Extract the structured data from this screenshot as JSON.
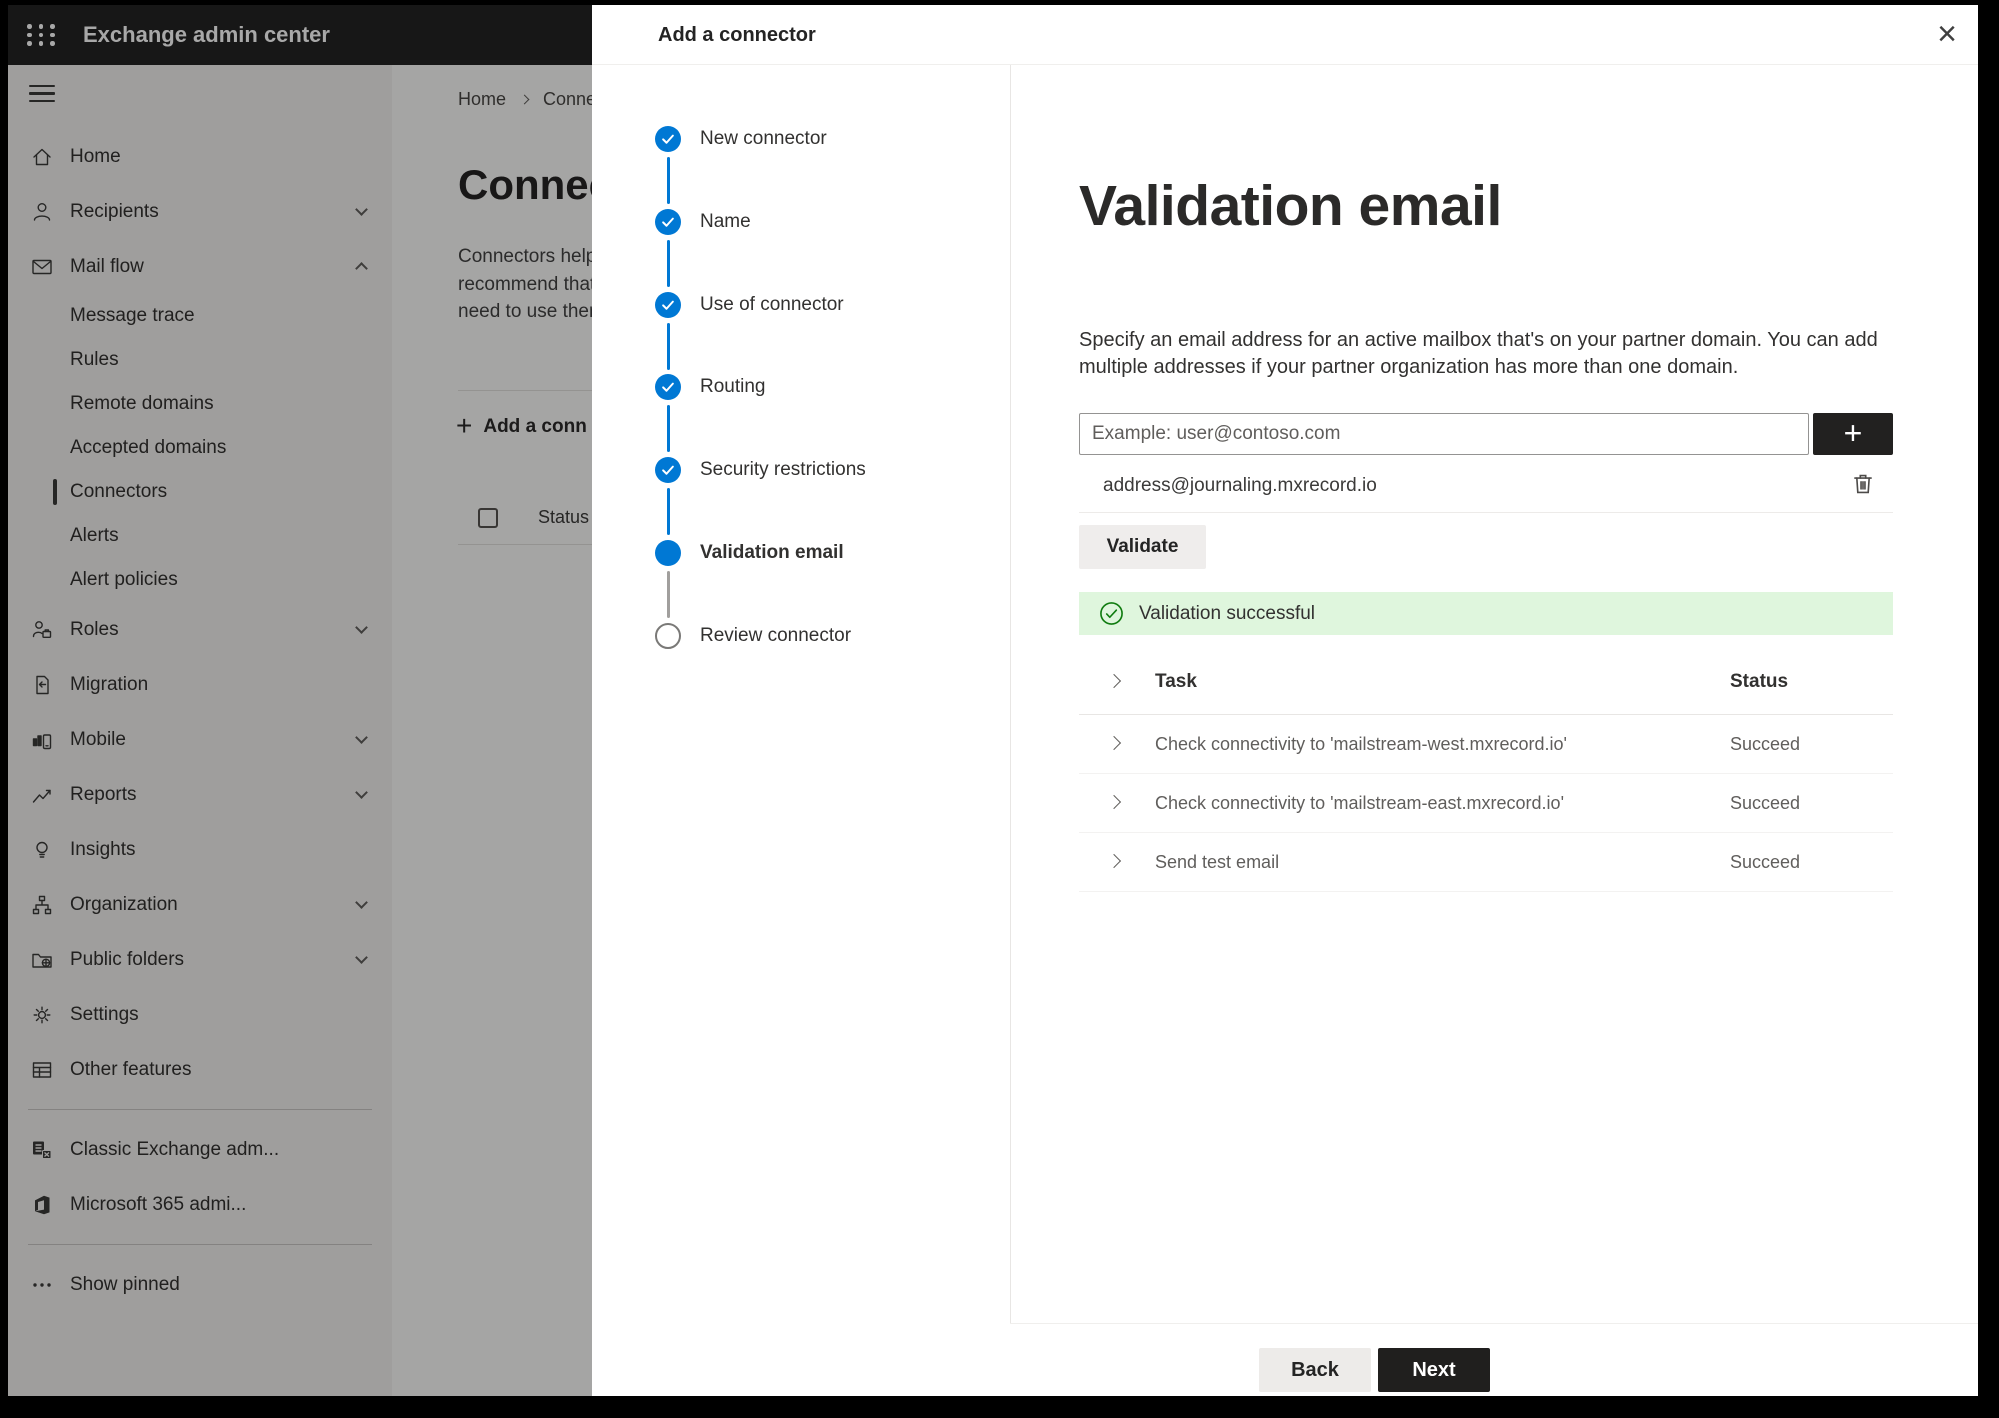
{
  "colors": {
    "accent": "#0078d4",
    "success_bg": "#dff6dd",
    "success_icon": "#107c10"
  },
  "top_bar": {
    "title": "Exchange admin center"
  },
  "sidebar": {
    "items": [
      {
        "icon": "home-icon",
        "label": "Home"
      },
      {
        "icon": "person-icon",
        "label": "Recipients",
        "chevron": "down"
      },
      {
        "icon": "mail-icon",
        "label": "Mail flow",
        "chevron": "up"
      },
      {
        "label": "Message trace",
        "sub": true
      },
      {
        "label": "Rules",
        "sub": true
      },
      {
        "label": "Remote domains",
        "sub": true
      },
      {
        "label": "Accepted domains",
        "sub": true
      },
      {
        "label": "Connectors",
        "sub": true,
        "selected": true
      },
      {
        "label": "Alerts",
        "sub": true
      },
      {
        "label": "Alert policies",
        "sub": true
      },
      {
        "icon": "roles-icon",
        "label": "Roles",
        "chevron": "down"
      },
      {
        "icon": "migration-icon",
        "label": "Migration"
      },
      {
        "icon": "mobile-icon",
        "label": "Mobile",
        "chevron": "down"
      },
      {
        "icon": "reports-icon",
        "label": "Reports",
        "chevron": "down"
      },
      {
        "icon": "insights-icon",
        "label": "Insights"
      },
      {
        "icon": "organization-icon",
        "label": "Organization",
        "chevron": "down"
      },
      {
        "icon": "public-folders-icon",
        "label": "Public folders",
        "chevron": "down"
      },
      {
        "icon": "settings-icon",
        "label": "Settings"
      },
      {
        "icon": "other-features-icon",
        "label": "Other features"
      },
      {
        "type": "divider"
      },
      {
        "icon": "classic-exchange-icon",
        "label": "Classic Exchange adm..."
      },
      {
        "icon": "microsoft-365-icon",
        "label": "Microsoft 365 admi..."
      },
      {
        "type": "divider"
      },
      {
        "icon": "ellipsis-icon",
        "label": "Show pinned"
      }
    ]
  },
  "background_page": {
    "breadcrumb": {
      "home": "Home",
      "current": "Conne"
    },
    "heading": "Connec",
    "paragraph_lines": [
      "Connectors help",
      "recommend that",
      "need to use ther"
    ],
    "add_button_label": "Add a conn",
    "list_header": "Status"
  },
  "panel": {
    "title": "Add a connector",
    "steps": [
      {
        "label": "New connector",
        "state": "completed"
      },
      {
        "label": "Name",
        "state": "completed"
      },
      {
        "label": "Use of connector",
        "state": "completed"
      },
      {
        "label": "Routing",
        "state": "completed"
      },
      {
        "label": "Security restrictions",
        "state": "completed"
      },
      {
        "label": "Validation email",
        "state": "current"
      },
      {
        "label": "Review connector",
        "state": "upcoming"
      }
    ],
    "heading": "Validation email",
    "description": "Specify an email address for an active mailbox that's on your partner domain. You can add multiple addresses if your partner organization has more than one domain.",
    "email_input_placeholder": "Example: user@contoso.com",
    "added_address": "address@journaling.mxrecord.io",
    "validate_button_label": "Validate",
    "success_message": "Validation successful",
    "results_table": {
      "columns": [
        "Task",
        "Status"
      ],
      "rows": [
        {
          "task": "Check connectivity to 'mailstream-west.mxrecord.io'",
          "status": "Succeed"
        },
        {
          "task": "Check connectivity to 'mailstream-east.mxrecord.io'",
          "status": "Succeed"
        },
        {
          "task": "Send test email",
          "status": "Succeed"
        }
      ]
    },
    "back_button_label": "Back",
    "next_button_label": "Next"
  }
}
